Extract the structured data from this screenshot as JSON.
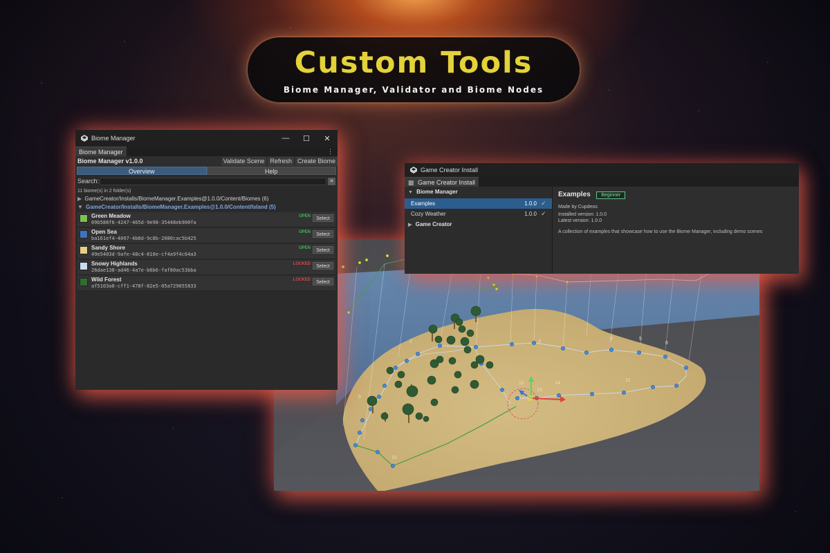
{
  "hero": {
    "title": "Custom Tools",
    "subtitle": "Biome Manager, Validator and Biome Nodes"
  },
  "biome_manager": {
    "window_title": "Biome Manager",
    "tab_label": "Biome Manager",
    "version_title": "Biome Manager v1.0.0",
    "buttons": {
      "validate": "Validate Scene",
      "refresh": "Refresh",
      "create": "Create Biome"
    },
    "toggles": {
      "overview": "Overview",
      "help": "Help"
    },
    "search_label": "Search:",
    "search_value": "",
    "count_text": "11 biome(s) in 2 folder(s)",
    "folders": [
      {
        "path": "GameCreator/Installs/BiomeManager.Examples@1.0.0/Content/Biomes",
        "count": "(6)"
      },
      {
        "path": "GameCreator/Installs/BiomeManager.Examples@1.0.0/Content/Island",
        "count": "(5)"
      }
    ],
    "biomes": [
      {
        "name": "Green Meadow",
        "id": "09b588f6-4247-465d-9e98-35448eb900fa",
        "status": "OPEN",
        "status_color": "#4caf50",
        "swatch": "#7cc24f",
        "select": "Select"
      },
      {
        "name": "Open Sea",
        "id": "ba161ef4-4097-4b8d-9c8b-2080cac5b425",
        "status": "OPEN",
        "status_color": "#4caf50",
        "swatch": "#3c73c2",
        "select": "Select"
      },
      {
        "name": "Sandy Shore",
        "id": "49e5403d-9afe-48c4-810e-cf4a9f4c64a3",
        "status": "OPEN",
        "status_color": "#4caf50",
        "swatch": "#e8cf86",
        "select": "Select"
      },
      {
        "name": "Snowy Highlands",
        "id": "26dae138-ad46-4a7e-b6b6-faf80ac53bba",
        "status": "LOCKED",
        "status_color": "#d04848",
        "swatch": "#c9dcf0",
        "select": "Select"
      },
      {
        "name": "Wild Forest",
        "id": "af5103a8-cff1-478f-82e5-05a729055833",
        "status": "LOCKED",
        "status_color": "#d04848",
        "swatch": "#2f6e2f",
        "select": "Select"
      }
    ]
  },
  "game_creator_install": {
    "window_title": "Game Creator Install",
    "tab_label": "Game Creator Install",
    "sections": [
      {
        "label": "Biome Manager",
        "items": [
          {
            "label": "Examples",
            "version": "1.0.0",
            "selected": true
          },
          {
            "label": "Cozy Weather",
            "version": "1.0.0",
            "selected": false
          }
        ]
      },
      {
        "label": "Game Creator",
        "items": []
      }
    ],
    "detail": {
      "title": "Examples",
      "badge": "Beginner",
      "author": "Made by Cupdeos",
      "installed": "Installed version: 1.0.0",
      "latest": "Latest version: 1.0.0",
      "description": "A collection of examples that showcase how to use the Biome Manager, including demo scenes"
    }
  },
  "scene": {
    "node_labels": [
      "2",
      "3",
      "4",
      "5",
      "6",
      "9",
      "10",
      "11",
      "12",
      "13",
      "14"
    ],
    "colors": {
      "sea": "#5d7fa6",
      "sand": "#cdb67e",
      "tree": "#2f5a33",
      "node": "#3b8ee8",
      "waypoint": "#d9f24a"
    }
  }
}
